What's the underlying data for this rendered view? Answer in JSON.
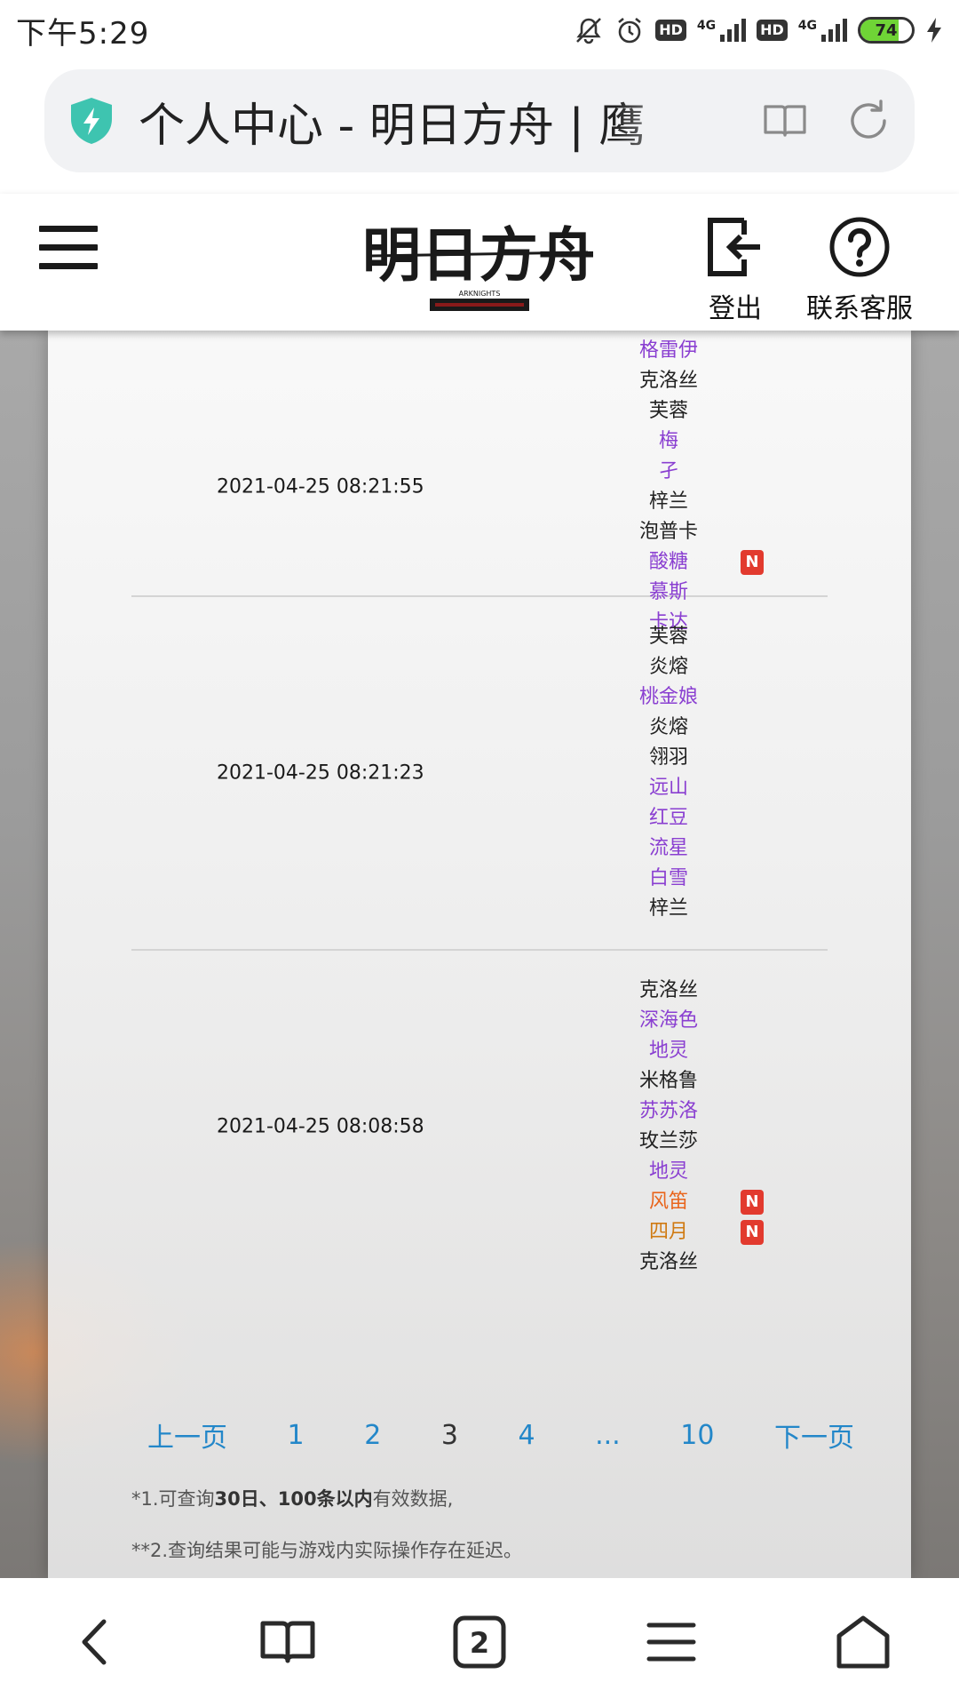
{
  "status_bar": {
    "time": "下午5:29",
    "hd": "HD",
    "network": "4G",
    "battery": "74",
    "battery_level": 0.74
  },
  "browser": {
    "url_title": "个人中心 - 明日方舟 | 鹰"
  },
  "header": {
    "logo_text": "明日方舟",
    "logo_subtext": "ARKNIGHTS",
    "logout_label": "登出",
    "support_label": "联系客服"
  },
  "records": [
    {
      "time": "2021-04-25 08:21:55",
      "operators": [
        {
          "name": "格雷伊",
          "rarity": "4",
          "new": ""
        },
        {
          "name": "克洛丝",
          "rarity": "3",
          "new": ""
        },
        {
          "name": "芙蓉",
          "rarity": "3",
          "new": ""
        },
        {
          "name": "梅",
          "rarity": "4",
          "new": ""
        },
        {
          "name": "孑",
          "rarity": "4",
          "new": ""
        },
        {
          "name": "梓兰",
          "rarity": "3",
          "new": ""
        },
        {
          "name": "泡普卡",
          "rarity": "3",
          "new": ""
        },
        {
          "name": "酸糖",
          "rarity": "4",
          "new": "N"
        },
        {
          "name": "慕斯",
          "rarity": "4",
          "new": ""
        },
        {
          "name": "卡达",
          "rarity": "4",
          "new": ""
        }
      ]
    },
    {
      "time": "2021-04-25 08:21:23",
      "operators": [
        {
          "name": "芙蓉",
          "rarity": "3",
          "new": ""
        },
        {
          "name": "炎熔",
          "rarity": "3",
          "new": ""
        },
        {
          "name": "桃金娘",
          "rarity": "4",
          "new": ""
        },
        {
          "name": "炎熔",
          "rarity": "3",
          "new": ""
        },
        {
          "name": "翎羽",
          "rarity": "3",
          "new": ""
        },
        {
          "name": "远山",
          "rarity": "4",
          "new": ""
        },
        {
          "name": "红豆",
          "rarity": "4",
          "new": ""
        },
        {
          "name": "流星",
          "rarity": "4",
          "new": ""
        },
        {
          "name": "白雪",
          "rarity": "4",
          "new": ""
        },
        {
          "name": "梓兰",
          "rarity": "3",
          "new": ""
        }
      ]
    },
    {
      "time": "2021-04-25 08:08:58",
      "operators": [
        {
          "name": "克洛丝",
          "rarity": "3",
          "new": ""
        },
        {
          "name": "深海色",
          "rarity": "4",
          "new": ""
        },
        {
          "name": "地灵",
          "rarity": "4",
          "new": ""
        },
        {
          "name": "米格鲁",
          "rarity": "3",
          "new": ""
        },
        {
          "name": "苏苏洛",
          "rarity": "4",
          "new": ""
        },
        {
          "name": "玫兰莎",
          "rarity": "3",
          "new": ""
        },
        {
          "name": "地灵",
          "rarity": "4",
          "new": ""
        },
        {
          "name": "风笛",
          "rarity": "6",
          "new": "N"
        },
        {
          "name": "四月",
          "rarity": "5",
          "new": "N"
        },
        {
          "name": "克洛丝",
          "rarity": "3",
          "new": ""
        }
      ]
    }
  ],
  "pagination": {
    "prev": "上一页",
    "pages": [
      "1",
      "2",
      "3",
      "4",
      "...",
      "10"
    ],
    "current": "3",
    "next": "下一页"
  },
  "notes": {
    "note1_prefix": "*1.可查询",
    "note1_bold": "30日、100条以内",
    "note1_suffix": "有效数据,",
    "note2": "**2.查询结果可能与游戏内实际操作存在延迟。"
  },
  "colors": {
    "rarity_3": "#222222",
    "rarity_4": "#8a3fd1",
    "rarity_5": "#d07a12",
    "rarity_6": "#e9651c",
    "link": "#2387c9",
    "new_badge": "#e23a2e"
  }
}
